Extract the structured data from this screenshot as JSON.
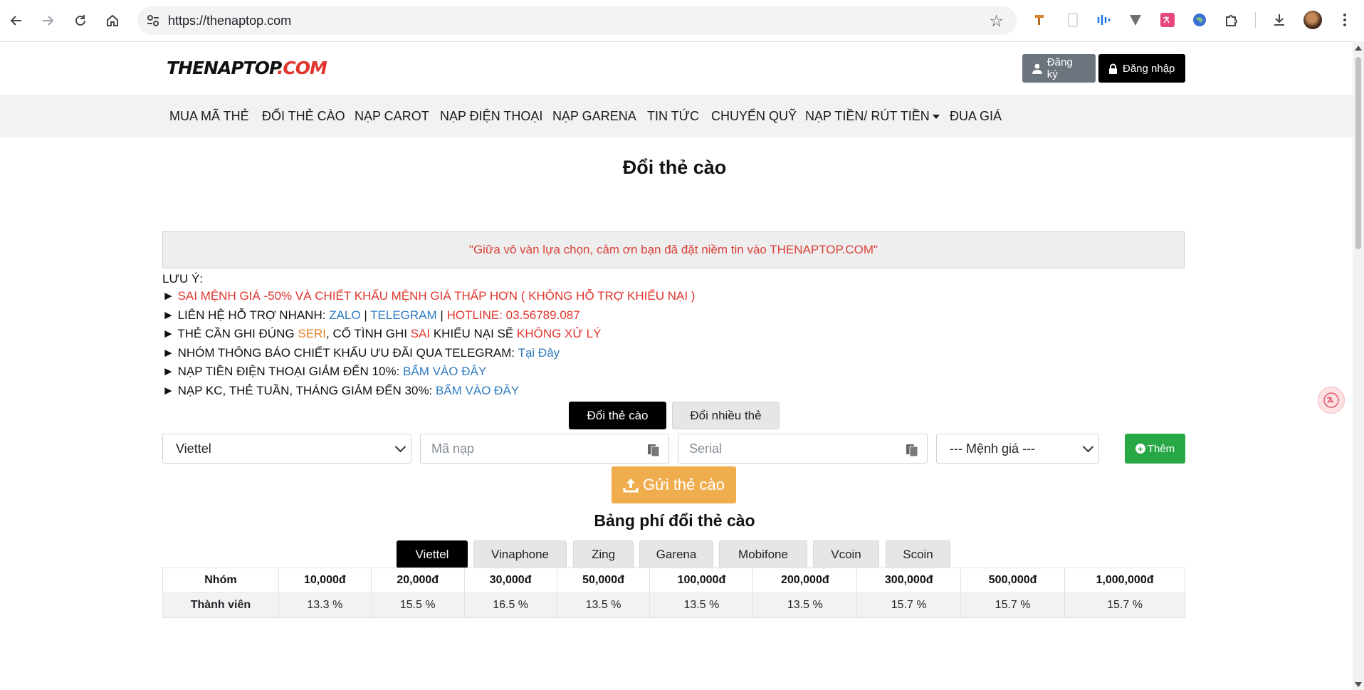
{
  "browser": {
    "url": "https://thenaptop.com",
    "back_icon": "arrow-left-icon",
    "forward_icon": "arrow-right-icon",
    "reload_icon": "reload-icon",
    "home_icon": "home-icon"
  },
  "header": {
    "logo_part1": "THENAPTOP",
    "logo_part2": ".COM",
    "register_label": "Đăng ký",
    "login_label": "Đăng nhập"
  },
  "menu": [
    {
      "label": "MUA MÃ THẺ"
    },
    {
      "label": "ĐỔI THẺ CÀO"
    },
    {
      "label": "NẠP CAROT"
    },
    {
      "label": "NẠP ĐIỆN THOẠI"
    },
    {
      "label": "NẠP GARENA"
    },
    {
      "label": "TIN TỨC"
    },
    {
      "label": "CHUYỂN QUỸ"
    },
    {
      "label": "NẠP TIỀN/ RÚT TIỀN"
    },
    {
      "label": "ĐUA GIÁ"
    }
  ],
  "page_title": "Đổi thẻ cào",
  "notice": "\"Giữa vô vàn lựa chọn, cảm ơn bạn đã đặt niềm tin vào THENAPTOP.COM\"",
  "notes": {
    "heading": "LƯU Ý:",
    "line1": "SAI MỆNH GIÁ -50% VÀ CHIẾT KHẤU MỆNH GIÁ THẤP HƠN ( KHÔNG HỖ TRỢ KHIẾU NẠI )",
    "line2_prefix": "LIÊN HỆ HỖ TRỢ NHANH: ",
    "line2_zalo": "ZALO",
    "line2_sep1": " | ",
    "line2_telegram": "TELEGRAM",
    "line2_sep2": " | ",
    "line2_hotline": "HOTLINE: 03.56789.087",
    "line3_a": "THẺ CẦN GHI ĐÚNG ",
    "line3_seri": "SERI",
    "line3_b": ", CỐ TÌNH GHI ",
    "line3_sai": "SAI",
    "line3_c": " KHIẾU NẠI SẼ ",
    "line3_khong": "KHÔNG XỬ LÝ",
    "line4_prefix": "NHÓM THÔNG BÁO CHIẾT KHẤU ƯU ĐÃI QUA TELEGRAM: ",
    "line4_link": "Tại Đây",
    "line5_prefix": "NẠP TIỀN ĐIỆN THOẠI GIẢM ĐẾN 10%: ",
    "line5_link": "BẤM VÀO ĐÂY",
    "line6_prefix": "NẠP KC, THẺ TUẦN, THÁNG GIẢM ĐẾN 30%: ",
    "line6_link": "BẤM VÀO ĐÂY"
  },
  "form_tabs": {
    "single": "Đổi thẻ cào",
    "multi": "Đổi nhiều thẻ"
  },
  "form": {
    "telco_selected": "Viettel",
    "code_placeholder": "Mã nạp",
    "serial_placeholder": "Serial",
    "amount_selected": "--- Mệnh giá ---",
    "add_label": "Thêm",
    "submit_label": "Gửi thẻ cào"
  },
  "fee_title": "Bảng phí đổi thẻ cào",
  "network_tabs": [
    "Viettel",
    "Vinaphone",
    "Zing",
    "Garena",
    "Mobifone",
    "Vcoin",
    "Scoin"
  ],
  "fee_table": {
    "headers": [
      "Nhóm",
      "10,000đ",
      "20,000đ",
      "30,000đ",
      "50,000đ",
      "100,000đ",
      "200,000đ",
      "300,000đ",
      "500,000đ",
      "1,000,000đ"
    ],
    "rows": [
      [
        "Thành viên",
        "13.3 %",
        "15.5 %",
        "16.5 %",
        "13.5 %",
        "13.5 %",
        "13.5 %",
        "15.7 %",
        "15.7 %",
        "15.7 %"
      ]
    ]
  },
  "colors": {
    "accent_red": "#e0342c",
    "link_blue": "#2f7bbf",
    "submit_orange": "#f0ad4e",
    "add_green": "#28a745"
  }
}
